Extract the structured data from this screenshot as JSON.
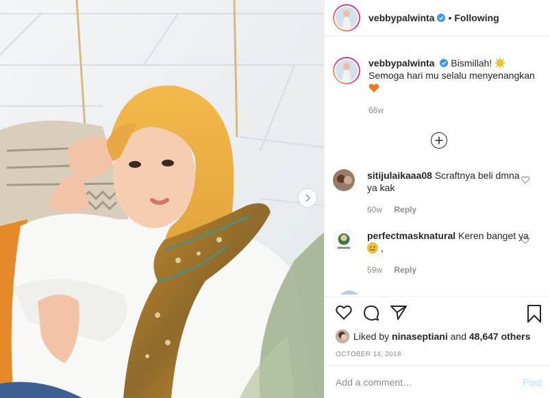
{
  "post": {
    "username": "vebbypalwinta",
    "follow_status": "Following",
    "caption_user": "vebbypalwinta",
    "caption_line1": "Bismillah!",
    "caption_line2": "Semoga hari mu selalu menyenangkan",
    "caption_age": "66w"
  },
  "comments": [
    {
      "user": "sitijulaikaaa08",
      "text": "Scraftnya beli dmna ya kak",
      "age": "60w",
      "reply_label": "Reply"
    },
    {
      "user": "perfectmasknatural",
      "text": "Keren banget ya",
      "text_suffix": ",",
      "age": "59w",
      "reply_label": "Reply"
    }
  ],
  "likes": {
    "prefix": "Liked by",
    "user": "ninaseptiani",
    "middle": "and",
    "count": "48,647 others"
  },
  "date": "OCTOBER 14, 2018",
  "comment_box": {
    "placeholder": "Add a comment…",
    "post_label": "Post"
  },
  "icons": {
    "verified": "verified-badge-icon",
    "sun_emoji": "sun-emoji-icon",
    "heart_emoji": "orange-heart-emoji-icon",
    "smile_emoji": "smiling-face-emoji-icon",
    "like": "heart-outline-icon",
    "comment": "comment-bubble-icon",
    "share": "paper-plane-icon",
    "save": "bookmark-icon",
    "load_more": "plus-circle-icon",
    "next": "chevron-right-icon"
  },
  "colors": {
    "verified": "#3897f0",
    "muted": "#8e8e8e",
    "text": "#262626",
    "post_disabled": "#b2dffc"
  }
}
